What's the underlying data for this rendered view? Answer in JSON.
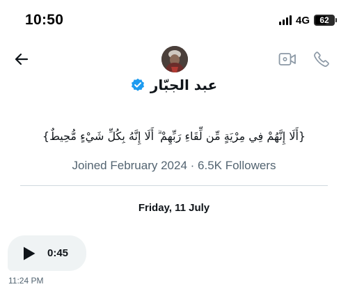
{
  "status_bar": {
    "time": "10:50",
    "network": "4G",
    "battery": "62",
    "battery_level": 0.62
  },
  "header": {
    "back_icon": "arrow-left-icon",
    "video_icon": "video-camera-icon",
    "call_icon": "phone-icon"
  },
  "profile": {
    "display_name": "عبد الجبّار",
    "verified": true,
    "verified_color": "#1d9bf0",
    "bio": "{أَلَا إِنَّهُمْ فِي مِرْيَةٍ مِّن لِّقَاءِ رَبِّهِمْ ۗ أَلَا إِنَّهُ بِكُلِّ شَيْءٍ مُّحِيطٌ}",
    "meta": "Joined February 2024 · 6.5K Followers"
  },
  "conversation": {
    "date_separator": "Friday, 11 July",
    "messages": [
      {
        "type": "voice",
        "duration": "0:45",
        "time": "11:24 PM"
      }
    ]
  },
  "colors": {
    "secondary_text": "#536471",
    "bubble_bg": "#eff3f4",
    "divider": "#cfd9de",
    "icon_muted": "#8b98a5"
  }
}
